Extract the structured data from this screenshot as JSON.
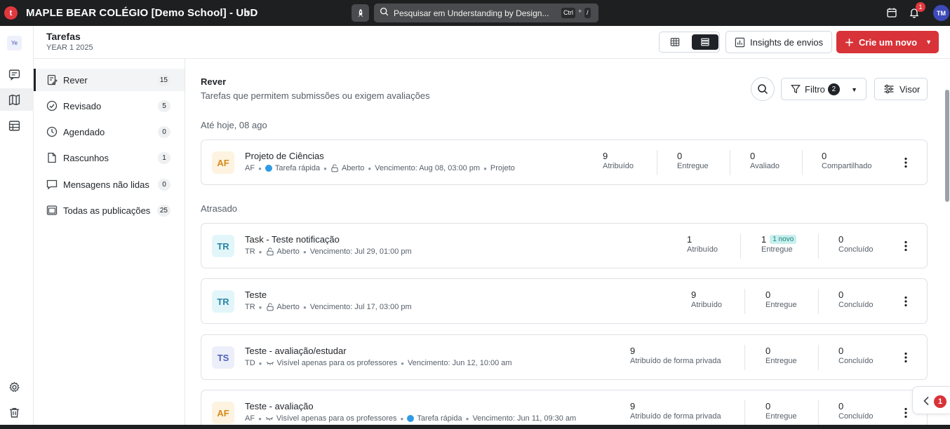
{
  "topbar": {
    "logo_letter": "t",
    "school_title": "MAPLE BEAR COLÉGIO [Demo School] - UbD",
    "search_placeholder": "Pesquisar em Understanding by Design...",
    "shortcut_ctrl": "Ctrl",
    "shortcut_plus": "+",
    "shortcut_slash": "/",
    "notification_count": "1",
    "avatar_initials": "TM"
  },
  "rail": {
    "class_chip": "Ye"
  },
  "header": {
    "title": "Tarefas",
    "subtitle": "YEAR 1 2025",
    "insights_label": "Insights de envios",
    "create_label": "Crie um novo"
  },
  "sidebar": {
    "items": [
      {
        "label": "Rever",
        "count": "15",
        "icon": "review-icon"
      },
      {
        "label": "Revisado",
        "count": "5",
        "icon": "check-circle-icon"
      },
      {
        "label": "Agendado",
        "count": "0",
        "icon": "clock-icon"
      },
      {
        "label": "Rascunhos",
        "count": "1",
        "icon": "draft-icon"
      },
      {
        "label": "Mensagens não lidas",
        "count": "0",
        "icon": "message-icon"
      },
      {
        "label": "Todas as publicações",
        "count": "25",
        "icon": "publications-icon"
      }
    ]
  },
  "main": {
    "title": "Rever",
    "subtitle": "Tarefas que permitem submissões ou exigem avaliações",
    "filter_label": "Filtro",
    "filter_count": "2",
    "visor_label": "Visor",
    "section_today": "Até hoje, 08 ago",
    "section_late": "Atrasado"
  },
  "cards": [
    {
      "badge": "AF",
      "title": "Projeto de Ciências",
      "meta": {
        "author": "AF",
        "type": "Tarefa rápida",
        "status": "Aberto",
        "due": "Vencimento: Aug 08, 03:00 pm",
        "extra": "Projeto"
      },
      "stats": [
        {
          "num": "9",
          "label": "Atribuído"
        },
        {
          "num": "0",
          "label": "Entregue"
        },
        {
          "num": "0",
          "label": "Avaliado"
        },
        {
          "num": "0",
          "label": "Compartilhado"
        }
      ]
    },
    {
      "badge": "TR",
      "title": "Task - Teste notificação",
      "meta": {
        "author": "TR",
        "status": "Aberto",
        "due": "Vencimento: Jul 29, 01:00 pm"
      },
      "stats": [
        {
          "num": "1",
          "label": "Atribuído"
        },
        {
          "num": "1",
          "label": "Entregue",
          "tag": "1 novo"
        },
        {
          "num": "0",
          "label": "Concluído"
        }
      ]
    },
    {
      "badge": "TR",
      "title": "Teste",
      "meta": {
        "author": "TR",
        "status": "Aberto",
        "due": "Vencimento: Jul 17, 03:00 pm"
      },
      "stats": [
        {
          "num": "9",
          "label": "Atribuído"
        },
        {
          "num": "0",
          "label": "Entregue"
        },
        {
          "num": "0",
          "label": "Concluído"
        }
      ]
    },
    {
      "badge": "TS",
      "title": "Teste - avaliação/estudar",
      "meta": {
        "author": "TD",
        "visibility": "Visível apenas para os professores",
        "due": "Vencimento: Jun 12, 10:00 am"
      },
      "stats": [
        {
          "num": "9",
          "label": "Atribuído de forma privada"
        },
        {
          "num": "0",
          "label": "Entregue"
        },
        {
          "num": "0",
          "label": "Concluído"
        }
      ]
    },
    {
      "badge": "AF",
      "title": "Teste - avaliação",
      "meta": {
        "author": "AF",
        "visibility": "Visível apenas para os professores",
        "type": "Tarefa rápida",
        "due": "Vencimento: Jun 11, 09:30 am"
      },
      "stats": [
        {
          "num": "9",
          "label": "Atribuído de forma privada"
        },
        {
          "num": "0",
          "label": "Entregue"
        },
        {
          "num": "0",
          "label": "Concluído"
        }
      ]
    }
  ],
  "floating": {
    "count": "1"
  },
  "colors": {
    "topbar": "#1e1f21",
    "accent_red": "#d83339",
    "badge_af_bg": "#fdf3e0",
    "badge_af_fg": "#d58a1b",
    "badge_tr_bg": "#e2f6fa",
    "badge_tr_fg": "#2a86a6",
    "badge_ts_bg": "#eceffa",
    "badge_ts_fg": "#4f61b8"
  }
}
